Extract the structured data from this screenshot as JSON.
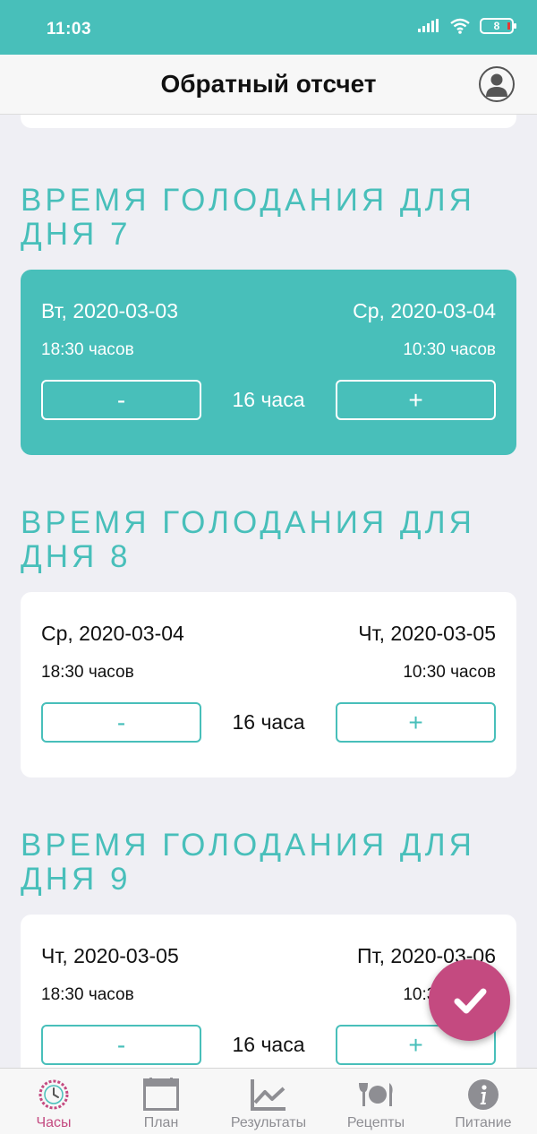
{
  "status_bar": {
    "time": "11:03",
    "battery": "8"
  },
  "header": {
    "title": "Обратный отсчет"
  },
  "sections": [
    {
      "title": "Время голодания для дня 7",
      "active": true,
      "start_date": "Вт, 2020-03-03",
      "end_date": "Ср, 2020-03-04",
      "start_time": "18:30 часов",
      "end_time": "10:30 часов",
      "minus_label": "-",
      "plus_label": "+",
      "duration": "16 часа"
    },
    {
      "title": "Время голодания для дня 8",
      "active": false,
      "start_date": "Ср, 2020-03-04",
      "end_date": "Чт, 2020-03-05",
      "start_time": "18:30 часов",
      "end_time": "10:30 часов",
      "minus_label": "-",
      "plus_label": "+",
      "duration": "16 часа"
    },
    {
      "title": "Время голодания для дня 9",
      "active": false,
      "start_date": "Чт, 2020-03-05",
      "end_date": "Пт, 2020-03-06",
      "start_time": "18:30 часов",
      "end_time": "10:30 часов",
      "minus_label": "-",
      "plus_label": "+",
      "duration": "16 часа"
    }
  ],
  "tabs": [
    {
      "label": "Часы",
      "icon": "clock-icon",
      "active": true
    },
    {
      "label": "План",
      "icon": "calendar-icon",
      "active": false
    },
    {
      "label": "Результаты",
      "icon": "chart-icon",
      "active": false
    },
    {
      "label": "Рецепты",
      "icon": "cutlery-icon",
      "active": false
    },
    {
      "label": "Питание",
      "icon": "info-icon",
      "active": false
    }
  ],
  "colors": {
    "primary": "#48bfba",
    "accent": "#c44a80",
    "background": "#efeff4"
  }
}
